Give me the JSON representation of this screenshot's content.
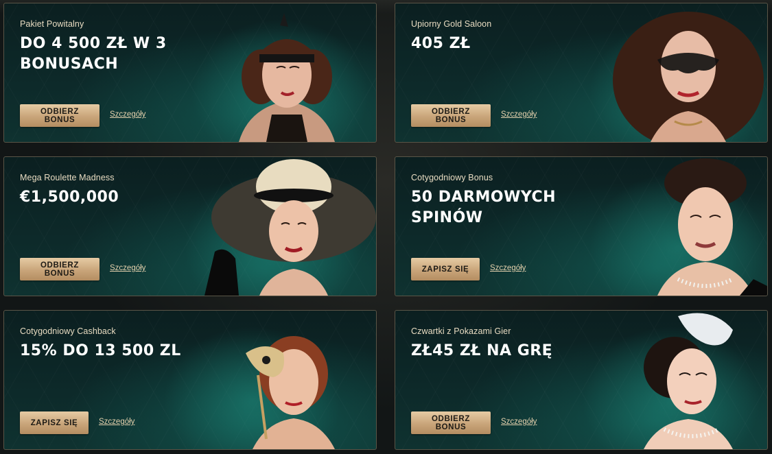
{
  "promotions": [
    {
      "subtitle": "Pakiet Powitalny",
      "title": "DO 4 500 ZŁ W 3 BONUSACH",
      "button_label": "ODBIERZ BONUS",
      "details_label": "Szczegóły",
      "image": "woman-with-headband-portrait"
    },
    {
      "subtitle": "Upiorny Gold Saloon",
      "title": "405 ZŁ",
      "button_label": "ODBIERZ BONUS",
      "details_label": "Szczegóły",
      "image": "woman-with-lace-mask-portrait"
    },
    {
      "subtitle": "Mega Roulette Madness",
      "title": "€1,500,000",
      "button_label": "ODBIERZ BONUS",
      "details_label": "Szczegóły",
      "image": "woman-with-wide-hat-portrait"
    },
    {
      "subtitle": "Cotygodniowy Bonus",
      "title": "50 DARMOWYCH SPINÓW",
      "button_label": "ZAPISZ SIĘ",
      "details_label": "Szczegóły",
      "image": "woman-with-pearls-portrait"
    },
    {
      "subtitle": "Cotygodniowy Cashback",
      "title": "15% DO 13 500 ZL",
      "button_label": "ZAPISZ SIĘ",
      "details_label": "Szczegóły",
      "image": "woman-with-gold-mask-portrait"
    },
    {
      "subtitle": "Czwartki z Pokazami Gier",
      "title": "ZŁ45 ZŁ NA GRĘ",
      "button_label": "ODBIERZ BONUS",
      "details_label": "Szczegóły",
      "image": "woman-with-feather-fascinator-portrait"
    }
  ],
  "colors": {
    "card_bg": "#0d2a2a",
    "button_gold": "#c9a57a",
    "title_text": "#ffffff",
    "subtitle_text": "#e9dcc2"
  }
}
